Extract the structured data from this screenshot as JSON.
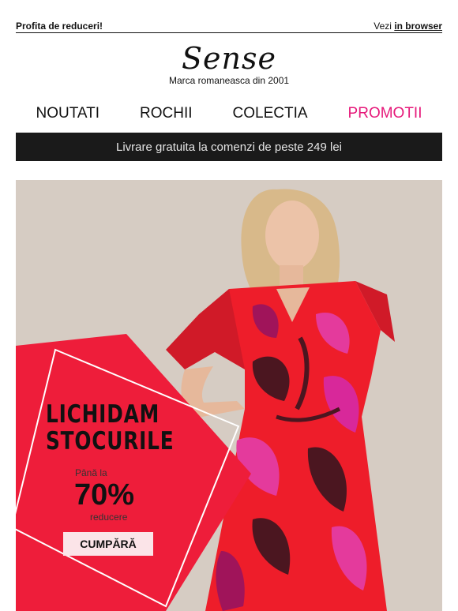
{
  "topbar": {
    "left_text": "Profita de reduceri!",
    "view_prefix": "Vezi",
    "view_link": "in browser"
  },
  "brand": {
    "logo": "Sense",
    "tagline": "Marca romaneasca din 2001"
  },
  "nav": {
    "items": [
      "NOUTATI",
      "ROCHII",
      "COLECTIA",
      "PROMOTII"
    ],
    "highlight_color": "#e6197a"
  },
  "shipping_bar": {
    "text": "Livrare gratuita la comenzi de peste 249 lei"
  },
  "hero": {
    "headline_line1": "LICHIDAM",
    "headline_line2": "STOCURILE",
    "up_to": "Până la",
    "percent": "70%",
    "discount_word": "reducere",
    "cta_label": "CUMPĂRĂ",
    "accent_color": "#ee1d3a"
  }
}
